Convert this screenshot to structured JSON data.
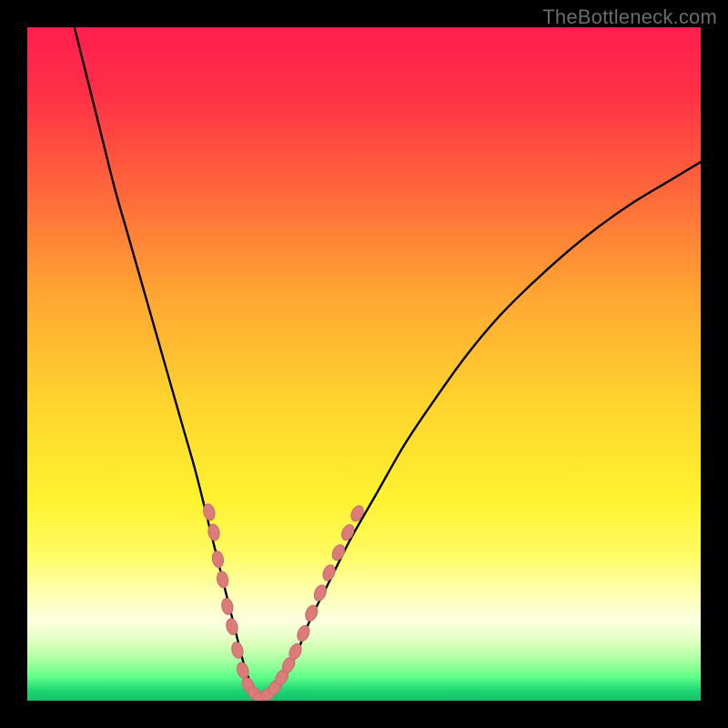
{
  "watermark": "TheBottleneck.com",
  "colors": {
    "frame": "#000000",
    "curve": "#000000",
    "marker_fill": "#db7b7a",
    "marker_stroke": "#c96a68",
    "gradient_stops": [
      {
        "offset": 0.0,
        "color": "#ff1e4f"
      },
      {
        "offset": 0.1,
        "color": "#ff3046"
      },
      {
        "offset": 0.25,
        "color": "#ff6a3a"
      },
      {
        "offset": 0.4,
        "color": "#ffa732"
      },
      {
        "offset": 0.55,
        "color": "#ffd22e"
      },
      {
        "offset": 0.7,
        "color": "#fff22f"
      },
      {
        "offset": 0.78,
        "color": "#fffb60"
      },
      {
        "offset": 0.84,
        "color": "#ffffb0"
      },
      {
        "offset": 0.88,
        "color": "#fdffe0"
      },
      {
        "offset": 0.905,
        "color": "#e9ffc8"
      },
      {
        "offset": 0.925,
        "color": "#c8ffb0"
      },
      {
        "offset": 0.945,
        "color": "#9cff9c"
      },
      {
        "offset": 0.965,
        "color": "#5eff88"
      },
      {
        "offset": 0.985,
        "color": "#1dd673"
      },
      {
        "offset": 1.0,
        "color": "#17c06b"
      }
    ]
  },
  "chart_data": {
    "type": "line",
    "title": "",
    "xlabel": "",
    "ylabel": "",
    "xlim": [
      0,
      100
    ],
    "ylim": [
      0,
      100
    ],
    "series": [
      {
        "name": "bottleneck-curve",
        "x": [
          7,
          9,
          11,
          13,
          15,
          17,
          19,
          21,
          23,
          25,
          27,
          28,
          29,
          30,
          31,
          32,
          33,
          34,
          35,
          36,
          38,
          40,
          42,
          45,
          48,
          52,
          56,
          60,
          65,
          70,
          75,
          80,
          85,
          90,
          95,
          100
        ],
        "y": [
          100,
          92,
          84,
          76,
          69,
          62,
          55,
          48,
          41,
          34,
          26,
          22,
          18,
          14,
          10,
          6,
          3,
          1,
          0.5,
          1,
          3,
          7,
          12,
          18,
          24,
          31,
          38,
          44,
          51,
          57,
          62,
          66.5,
          70.5,
          74,
          77,
          80
        ]
      }
    ],
    "markers": {
      "name": "highlighted-points",
      "points": [
        {
          "x": 27.0,
          "y": 28
        },
        {
          "x": 27.7,
          "y": 25
        },
        {
          "x": 28.3,
          "y": 21
        },
        {
          "x": 29.0,
          "y": 18
        },
        {
          "x": 29.7,
          "y": 14
        },
        {
          "x": 30.4,
          "y": 11
        },
        {
          "x": 31.2,
          "y": 7.5
        },
        {
          "x": 32.0,
          "y": 4.5
        },
        {
          "x": 32.8,
          "y": 2.3
        },
        {
          "x": 33.8,
          "y": 1.0
        },
        {
          "x": 34.8,
          "y": 0.5
        },
        {
          "x": 35.8,
          "y": 1.0
        },
        {
          "x": 36.8,
          "y": 2.0
        },
        {
          "x": 37.8,
          "y": 3.5
        },
        {
          "x": 38.8,
          "y": 5.3
        },
        {
          "x": 39.8,
          "y": 7.3
        },
        {
          "x": 41.0,
          "y": 10.0
        },
        {
          "x": 42.2,
          "y": 13.0
        },
        {
          "x": 43.5,
          "y": 16.0
        },
        {
          "x": 44.8,
          "y": 19.0
        },
        {
          "x": 46.2,
          "y": 22.0
        },
        {
          "x": 47.6,
          "y": 25.0
        },
        {
          "x": 49.0,
          "y": 27.8
        }
      ]
    }
  }
}
